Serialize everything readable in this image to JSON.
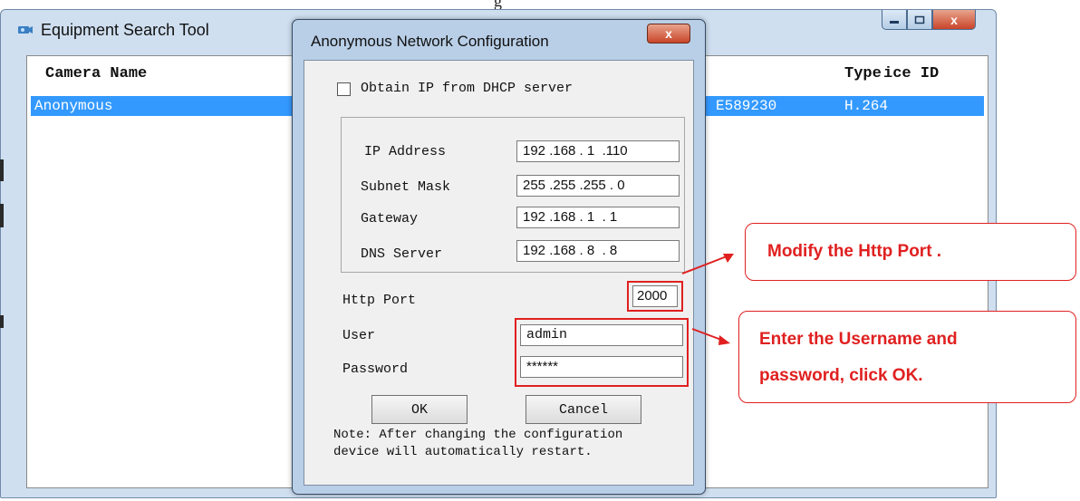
{
  "background_window": {
    "title": "Equipment Search Tool",
    "controls": {
      "minimize": "–",
      "maximize": "□",
      "close": "x"
    },
    "columns": [
      "Camera Name",
      "ice ID",
      "Type"
    ],
    "rows": [
      {
        "camera_name": "Anonymous",
        "device_id_partial": "E589230",
        "type": "H.264"
      }
    ]
  },
  "top_strip_text": "g",
  "dialog": {
    "title": "Anonymous Network Configuration",
    "close": "x",
    "dhcp_label": "Obtain IP from DHCP server",
    "dhcp_checked": false,
    "fields": {
      "ip_label": "IP Address",
      "ip_value": "192 .168 . 1  .110",
      "mask_label": "Subnet Mask",
      "mask_value": "255 .255 .255 . 0",
      "gateway_label": "Gateway",
      "gateway_value": "192 .168 . 1  . 1",
      "dns_label": "DNS Server",
      "dns_value": "192 .168 . 8  . 8",
      "http_port_label": "Http Port",
      "http_port_value": "2000",
      "user_label": "User",
      "user_value": "admin",
      "password_label": "Password",
      "password_value": "******"
    },
    "ok_label": "OK",
    "cancel_label": "Cancel",
    "note_line1": "Note: After changing the configuration",
    "note_line2": "device will automatically restart."
  },
  "callouts": {
    "port": "Modify the Http Port .",
    "login_line1": "Enter the Username and",
    "login_line2": "password, click OK."
  },
  "colors": {
    "selection": "#3399ff",
    "highlight": "#e02020",
    "dialog_frame": "#b9cfe7"
  }
}
